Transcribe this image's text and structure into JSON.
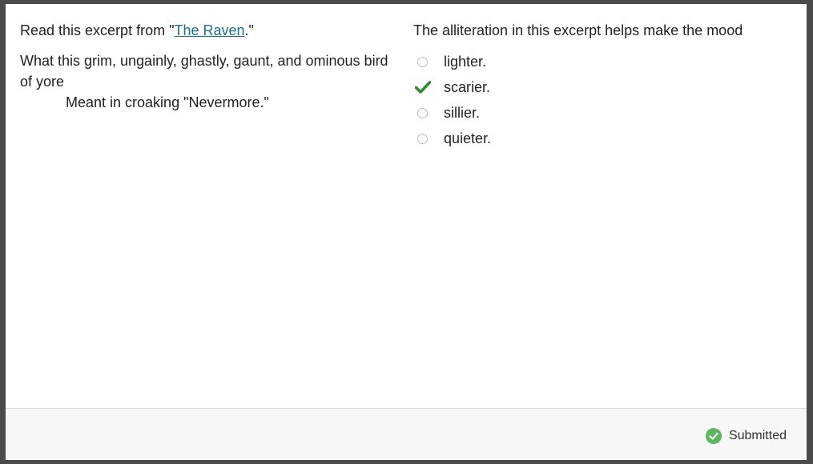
{
  "passage": {
    "intro_prefix": "Read this excerpt from \"",
    "link_text": "The Raven",
    "intro_suffix": ".\"",
    "line1": "What this grim, ungainly, ghastly, gaunt, and ominous bird of yore",
    "line2": "Meant in croaking \"Nevermore.\""
  },
  "question": {
    "text": "The alliteration in this excerpt helps make the mood",
    "options": [
      {
        "label": "lighter.",
        "state": "unselected"
      },
      {
        "label": "scarier.",
        "state": "correct"
      },
      {
        "label": "sillier.",
        "state": "unselected"
      },
      {
        "label": "quieter.",
        "state": "unselected"
      }
    ]
  },
  "footer": {
    "status_text": "Submitted",
    "status_icon": "check-circle-icon"
  },
  "colors": {
    "link": "#1a6e8e",
    "correct": "#2e8b2e",
    "submitted_badge": "#5cb85c"
  }
}
